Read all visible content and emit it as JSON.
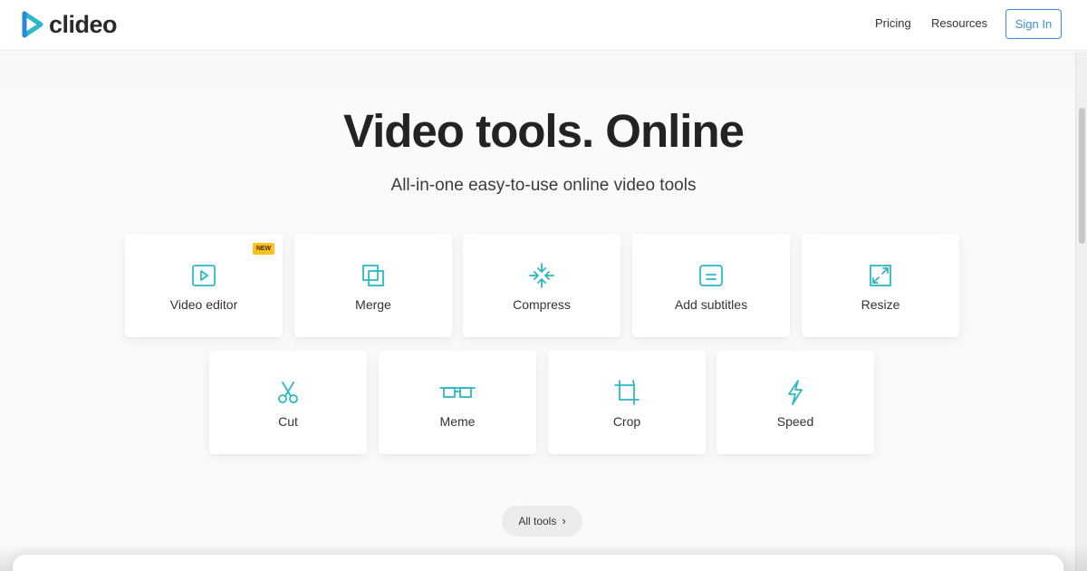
{
  "brand": {
    "name": "clideo",
    "colors": {
      "accent": "#2cb8c6",
      "link_blue": "#3a8fd8",
      "badge": "#ffc21c"
    }
  },
  "header": {
    "nav": [
      {
        "label": "Pricing"
      },
      {
        "label": "Resources"
      }
    ],
    "signin_label": "Sign In"
  },
  "hero": {
    "title": "Video tools. Online",
    "subtitle": "All-in-one easy-to-use online video tools"
  },
  "tools": [
    {
      "label": "Video editor",
      "icon": "play-icon",
      "badge": "NEW"
    },
    {
      "label": "Merge",
      "icon": "merge-icon"
    },
    {
      "label": "Compress",
      "icon": "compress-icon"
    },
    {
      "label": "Add subtitles",
      "icon": "subtitles-icon"
    },
    {
      "label": "Resize",
      "icon": "resize-icon"
    },
    {
      "label": "Cut",
      "icon": "scissors-icon"
    },
    {
      "label": "Meme",
      "icon": "glasses-icon"
    },
    {
      "label": "Crop",
      "icon": "crop-icon"
    },
    {
      "label": "Speed",
      "icon": "lightning-icon"
    }
  ],
  "all_tools": {
    "label": "All tools",
    "icon": "chevron-right-icon"
  }
}
